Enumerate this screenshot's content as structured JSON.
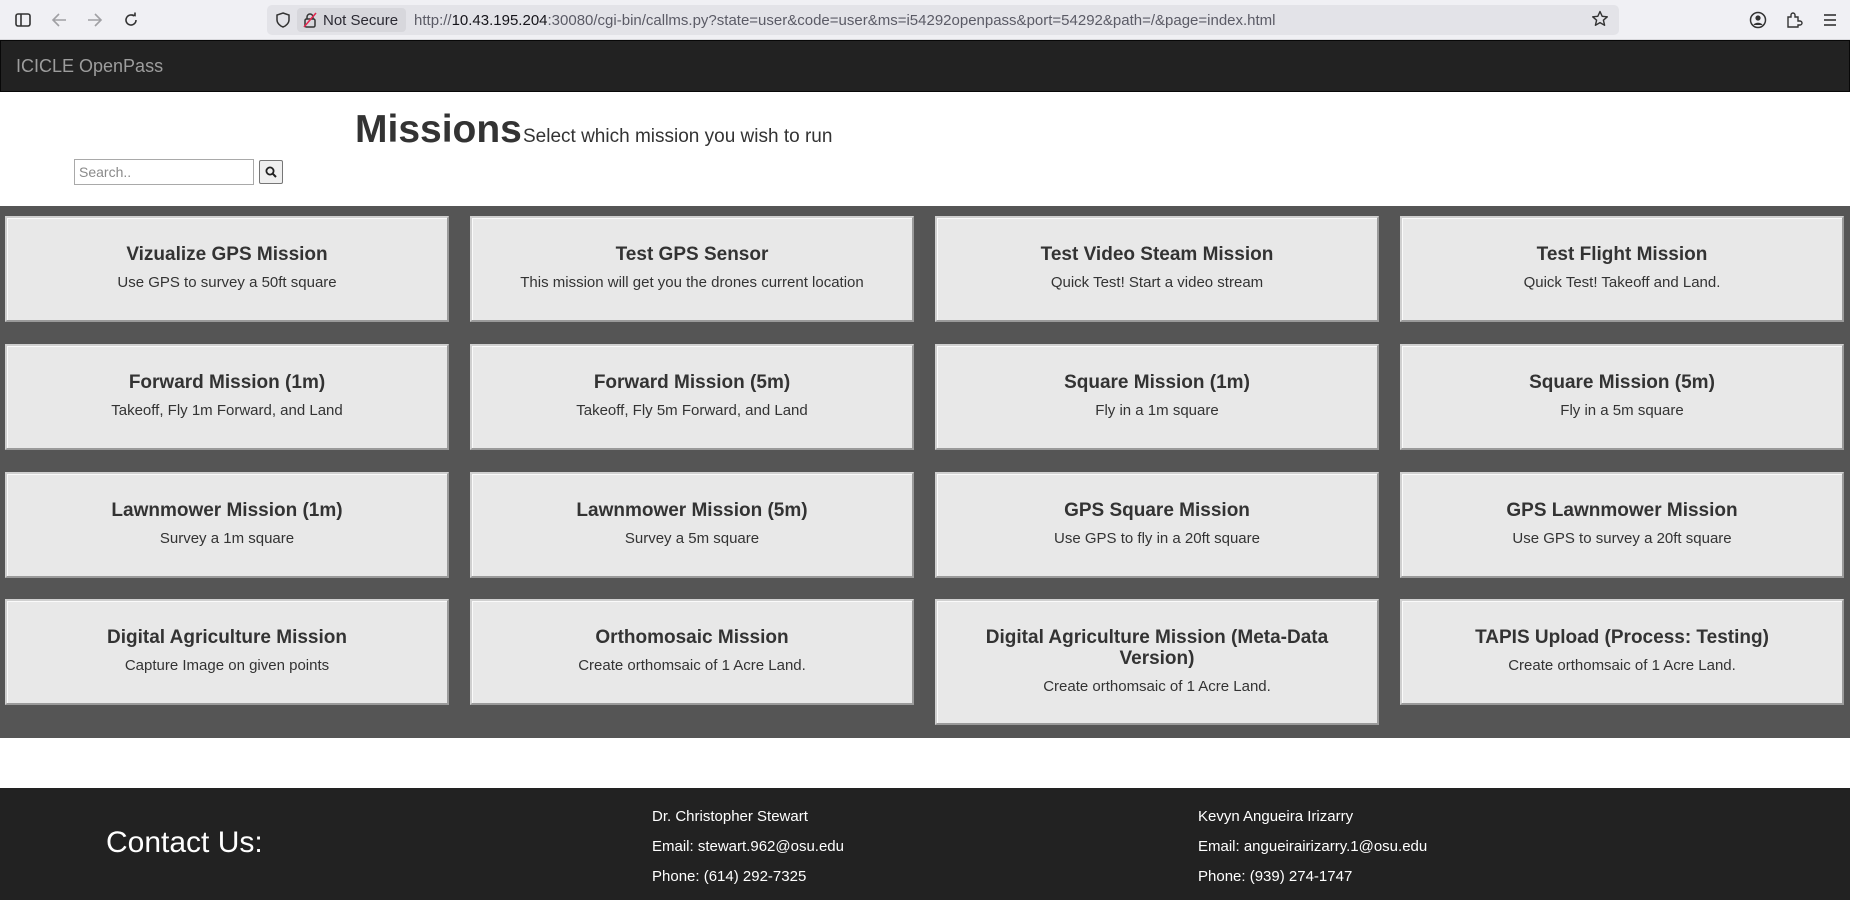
{
  "browser": {
    "security_label": "Not Secure",
    "url_prefix": "http://",
    "url_host": "10.43.195.204",
    "url_rest": ":30080/cgi-bin/callms.py?state=user&code=user&ms=i54292openpass&port=54292&path=/&page=index.html"
  },
  "navbar": {
    "brand": "ICICLE OpenPass"
  },
  "header": {
    "title": "Missions",
    "subtitle": "Select which mission you wish to run"
  },
  "search": {
    "placeholder": "Search.."
  },
  "missions": [
    {
      "title": "Vizualize GPS Mission",
      "desc": "Use GPS to survey a 50ft square"
    },
    {
      "title": "Test GPS Sensor",
      "desc": "This mission will get you the drones current location"
    },
    {
      "title": "Test Video Steam Mission",
      "desc": "Quick Test! Start a video stream"
    },
    {
      "title": "Test Flight Mission",
      "desc": "Quick Test! Takeoff and Land."
    },
    {
      "title": "Forward Mission (1m)",
      "desc": "Takeoff, Fly 1m Forward, and Land"
    },
    {
      "title": "Forward Mission (5m)",
      "desc": "Takeoff, Fly 5m Forward, and Land"
    },
    {
      "title": "Square Mission (1m)",
      "desc": "Fly in a 1m square"
    },
    {
      "title": "Square Mission (5m)",
      "desc": "Fly in a 5m square"
    },
    {
      "title": "Lawnmower Mission (1m)",
      "desc": "Survey a 1m square"
    },
    {
      "title": "Lawnmower Mission (5m)",
      "desc": "Survey a 5m square"
    },
    {
      "title": "GPS Square Mission",
      "desc": "Use GPS to fly in a 20ft square"
    },
    {
      "title": "GPS Lawnmower Mission",
      "desc": "Use GPS to survey a 20ft square"
    },
    {
      "title": "Digital Agriculture Mission",
      "desc": "Capture Image on given points"
    },
    {
      "title": "Orthomosaic Mission",
      "desc": "Create orthomsaic of 1 Acre Land."
    },
    {
      "title": "Digital Agriculture Mission (Meta-Data Version)",
      "desc": "Create orthomsaic of 1 Acre Land."
    },
    {
      "title": "TAPIS Upload (Process: Testing)",
      "desc": "Create orthomsaic of 1 Acre Land."
    }
  ],
  "footer": {
    "title": "Contact Us:",
    "contacts": [
      {
        "name": "Dr. Christopher Stewart",
        "email": "Email: stewart.962@osu.edu",
        "phone": "Phone: (614) 292-7325"
      },
      {
        "name": "Kevyn Angueira Irizarry",
        "email": "Email: angueirairizarry.1@osu.edu",
        "phone": "Phone: (939) 274-1747"
      }
    ]
  }
}
